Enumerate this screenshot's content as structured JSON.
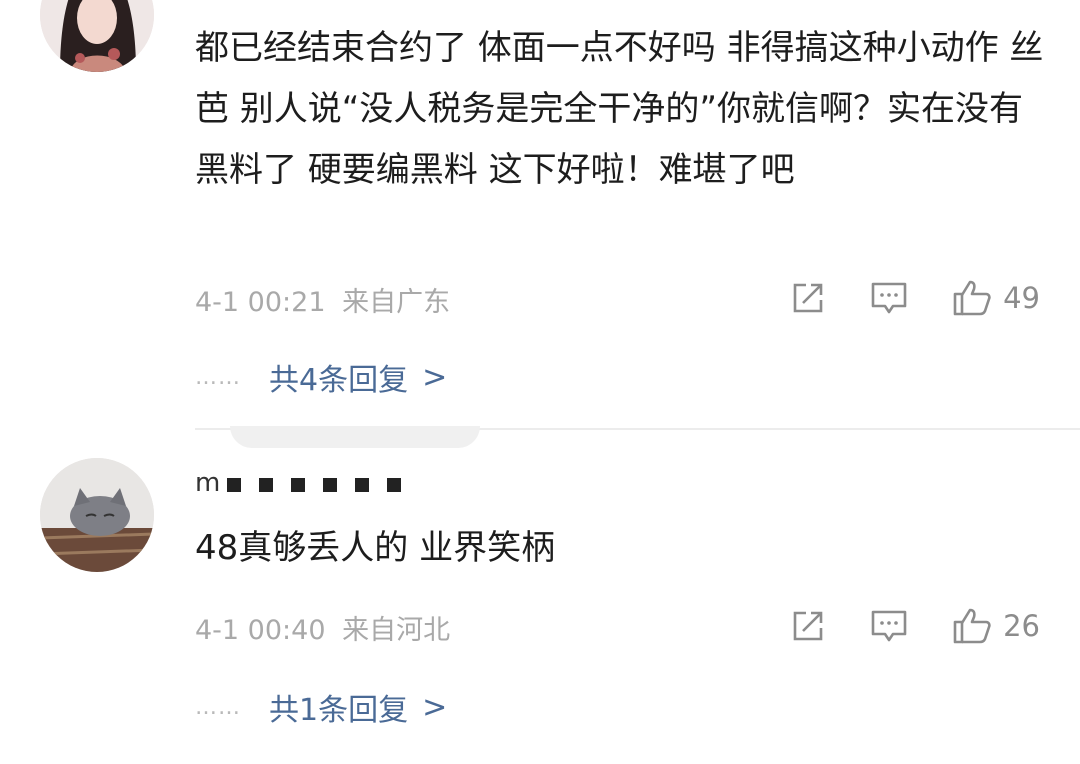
{
  "comments": [
    {
      "username": "",
      "avatar_icon": "avatar-woman-photo",
      "text": "都已经结束合约了  体面一点不好吗  非得搞这种小动作 丝芭  别人说“没人税务是完全干净的”你就信啊？实在没有黑料了 硬要编黑料  这下好啦！难堪了吧",
      "timestamp": "4-1 00:21",
      "location": "来自广东",
      "actions": {
        "share_icon": "share-icon",
        "comment_icon": "comment-icon",
        "like_icon": "thumbs-up-icon",
        "likes": "49"
      },
      "replies_label": "共4条回复",
      "replies_dots": "……",
      "replies_chevron": ">"
    },
    {
      "username": "m",
      "avatar_icon": "avatar-cat-photo",
      "text": "48真够丢人的 业界笑柄",
      "timestamp": "4-1 00:40",
      "location": "来自河北",
      "actions": {
        "share_icon": "share-icon",
        "comment_icon": "comment-icon",
        "like_icon": "thumbs-up-icon",
        "likes": "26"
      },
      "replies_label": "共1条回复",
      "replies_dots": "……",
      "replies_chevron": ">"
    }
  ]
}
